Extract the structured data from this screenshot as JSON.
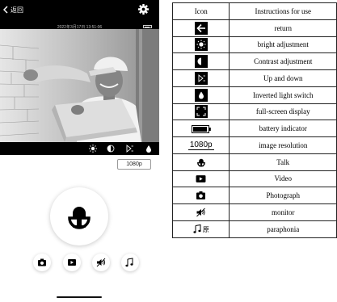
{
  "phone": {
    "back_label": "返回",
    "timestamp": "2022年3月17日 13:51:06",
    "battery_level": 0.8,
    "resolution": "1080p"
  },
  "legend": {
    "header_icon": "Icon",
    "header_text": "Instructions for use",
    "rows": [
      {
        "icon": "return-icon",
        "text": "return"
      },
      {
        "icon": "brightness-icon",
        "text": "bright adjustment"
      },
      {
        "icon": "contrast-icon",
        "text": "Contrast adjustment"
      },
      {
        "icon": "flip-up-down-icon",
        "text": "Up and down"
      },
      {
        "icon": "inverted-light-icon",
        "text": "Inverted light switch"
      },
      {
        "icon": "fullscreen-icon",
        "text": "full-screen display"
      },
      {
        "icon": "battery-icon",
        "text": "battery indicator"
      },
      {
        "icon": "resolution-label",
        "text": "image resolution",
        "label": "1080p"
      },
      {
        "icon": "talk-icon",
        "text": "Talk"
      },
      {
        "icon": "video-icon",
        "text": "Video"
      },
      {
        "icon": "camera-icon",
        "text": "Photograph"
      },
      {
        "icon": "speaker-icon",
        "text": "monitor"
      },
      {
        "icon": "voice-change-icon",
        "text": "paraphonia",
        "label": "原"
      }
    ]
  }
}
